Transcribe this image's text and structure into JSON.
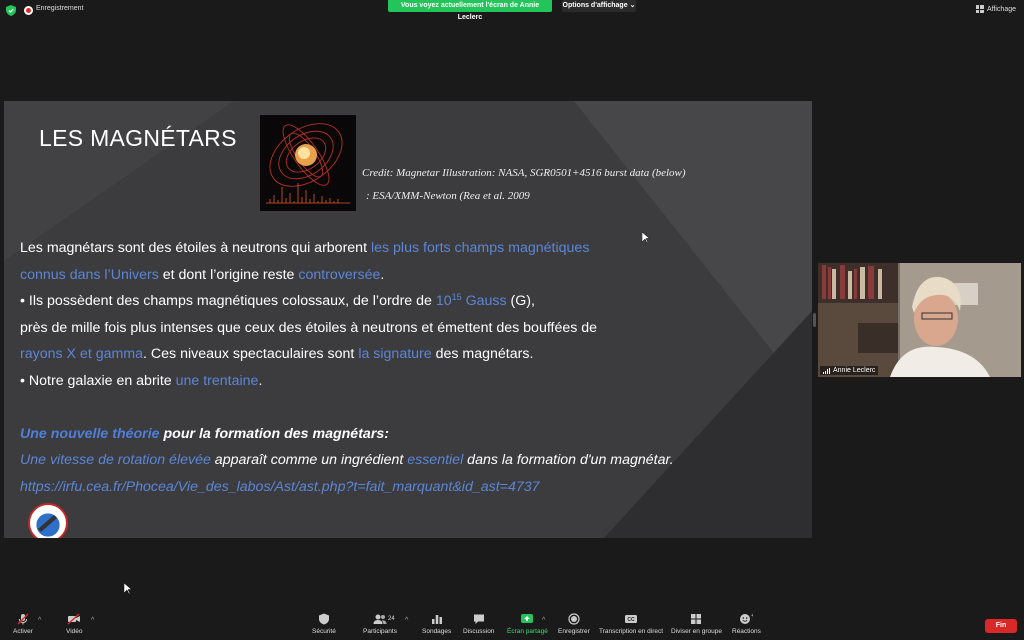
{
  "topbar": {
    "recording_label": "Enregistrement",
    "share_banner": "Vous voyez actuellement l'écran de Annie Leclerc",
    "view_options": "Options d'affichage",
    "view_button": "Affichage"
  },
  "slide": {
    "title": "LES MAGNÉTARS",
    "credit_line1": "Credit:  Magnetar Illustration: NASA, SGR0501+4516 burst data (below)",
    "credit_line2": ": ESA/XMM-Newton (Rea et al. 2009",
    "p1_a": "Les magnétars sont des étoiles à neutrons qui arborent ",
    "p1_b": "les plus forts champs magnétiques",
    "p2_a": " connus dans l’Univers",
    "p2_b": " et dont l’origine reste ",
    "p2_c": "controversée",
    "p2_d": ".",
    "p3_a": "•  Ils possèdent des champs magnétiques colossaux, de l’ordre de ",
    "p3_base": "10",
    "p3_exp": "15",
    "p3_b": " Gauss",
    "p3_c": " (G),",
    "p4": "près de mille fois plus intenses que ceux des étoiles à neutrons et émettent des bouffées de",
    "p5_a": "rayons X et gamma",
    "p5_b": ". Ces niveaux spectaculaires sont ",
    "p5_c": "la signature",
    "p5_d": " des magnétars.",
    "p6_a": "•  Notre galaxie en abrite ",
    "p6_b": "une trentaine",
    "p6_c": ".",
    "p7_a": "Une nouvelle théorie",
    "p7_b": " pour la formation des magnétars:",
    "p8_a": "Une vitesse de rotation élevée",
    "p8_b": " apparaît comme un ingrédient ",
    "p8_c": "essentiel",
    "p8_d": " dans la formation d'un magnétar.",
    "p9": " https://irfu.cea.fr/Phocea/Vie_des_labos/Ast/ast.php?t=fait_marquant&id_ast=4737"
  },
  "video": {
    "participant_name": "Annie Leclerc"
  },
  "toolbar": {
    "mute_label": "Activer",
    "video_label": "Vidéo",
    "security_label": "Sécurité",
    "participants_label": "Participants",
    "participants_count": "24",
    "polls_label": "Sondages",
    "chat_label": "Discussion",
    "share_label": "Écran partagé",
    "record_label": "Enregistrer",
    "cc_label": "Transcription en direct",
    "breakout_label": "Diviser en groupe",
    "reactions_label": "Réactions",
    "end_label": "Fin"
  },
  "colors": {
    "share_green": "#23c45a",
    "end_red": "#d92828",
    "slide_link_blue": "#5b86d6"
  }
}
